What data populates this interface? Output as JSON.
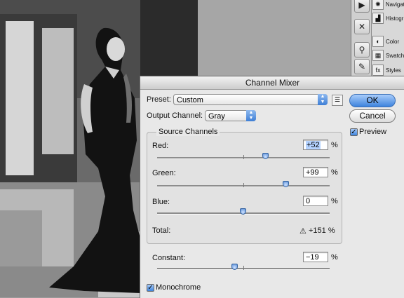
{
  "palette": {
    "items": [
      {
        "label": "Navigat",
        "icon": "navigator-icon"
      },
      {
        "label": "Histogr",
        "icon": "histogram-icon"
      },
      {
        "label": "Color",
        "icon": "color-icon"
      },
      {
        "label": "Swatch",
        "icon": "swatches-icon"
      },
      {
        "label": "Styles",
        "icon": "styles-icon"
      }
    ]
  },
  "dialog": {
    "title": "Channel Mixer",
    "preset_label": "Preset:",
    "preset_value": "Custom",
    "output_label": "Output Channel:",
    "output_value": "Gray",
    "source_title": "Source Channels",
    "channels": [
      {
        "label": "Red:",
        "value": "+52",
        "level": 52
      },
      {
        "label": "Green:",
        "value": "+99",
        "level": 99
      },
      {
        "label": "Blue:",
        "value": "0",
        "level": 0
      }
    ],
    "percent": "%",
    "total_label": "Total:",
    "total_value": "+151 %",
    "constant_label": "Constant:",
    "constant_value": "−19",
    "constant_level": -19,
    "monochrome_label": "Monochrome",
    "monochrome_checked": true,
    "ok_label": "OK",
    "cancel_label": "Cancel",
    "preview_label": "Preview",
    "preview_checked": true
  }
}
